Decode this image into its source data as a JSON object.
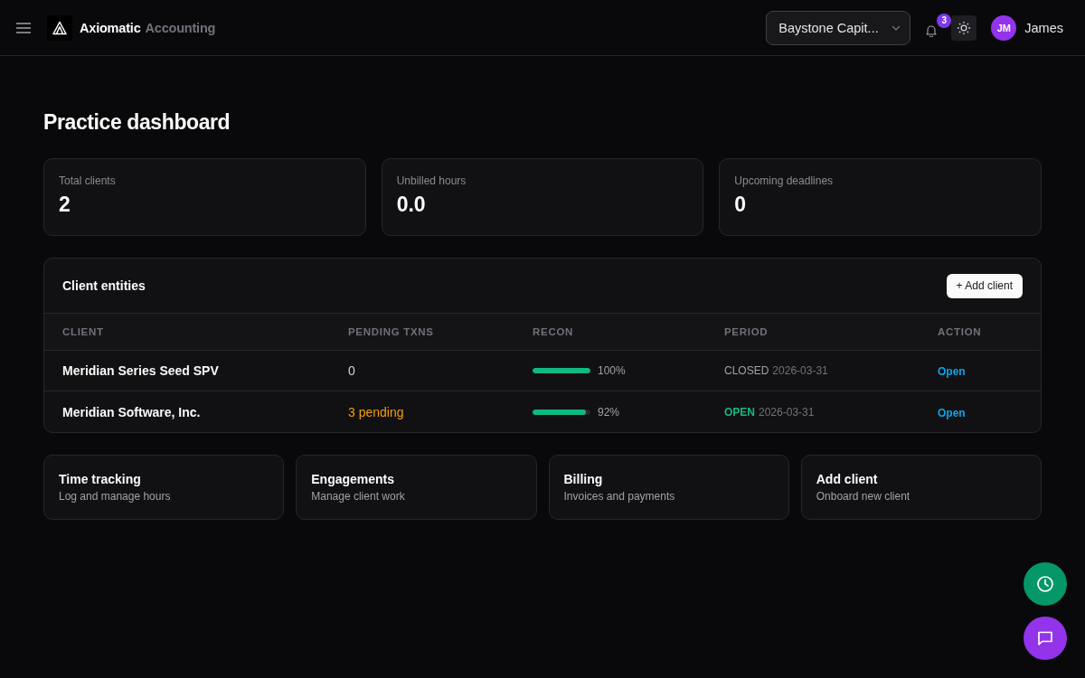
{
  "header": {
    "brand": {
      "name": "Axiomatic",
      "product": "Accounting"
    },
    "entity_select": {
      "value": "Baystone Capit..."
    },
    "notifications": {
      "count": "3"
    },
    "user": {
      "initials": "JM",
      "name": "James"
    }
  },
  "page": {
    "title": "Practice dashboard"
  },
  "stats": [
    {
      "label": "Total clients",
      "value": "2"
    },
    {
      "label": "Unbilled hours",
      "value": "0.0"
    },
    {
      "label": "Upcoming deadlines",
      "value": "0"
    }
  ],
  "clients_table": {
    "title": "Client entities",
    "add_button": "+ Add client",
    "columns": [
      "CLIENT",
      "PENDING TXNS",
      "RECON",
      "PERIOD",
      "ACTION"
    ],
    "rows": [
      {
        "client": "Meridian Series Seed SPV",
        "pending": "0",
        "pending_alert": false,
        "recon": {
          "level": 1.0,
          "reading": "100%"
        },
        "period": {
          "status": "CLOSED",
          "kind": "closed",
          "date": "2026-03-31"
        },
        "action": "Open"
      },
      {
        "client": "Meridian Software, Inc.",
        "pending": "3 pending",
        "pending_alert": true,
        "recon": {
          "level": 0.92,
          "reading": "92%"
        },
        "period": {
          "status": "OPEN",
          "kind": "open",
          "date": "2026-03-31"
        },
        "action": "Open"
      }
    ]
  },
  "quick_links": [
    {
      "title": "Time tracking",
      "subtitle": "Log and manage hours"
    },
    {
      "title": "Engagements",
      "subtitle": "Manage client work"
    },
    {
      "title": "Billing",
      "subtitle": "Invoices and payments"
    },
    {
      "title": "Add client",
      "subtitle": "Onboard new client"
    }
  ],
  "floating_buttons": [
    {
      "kind": "timer",
      "color": "#059669"
    },
    {
      "kind": "chat",
      "color": "#9333ea"
    }
  ]
}
